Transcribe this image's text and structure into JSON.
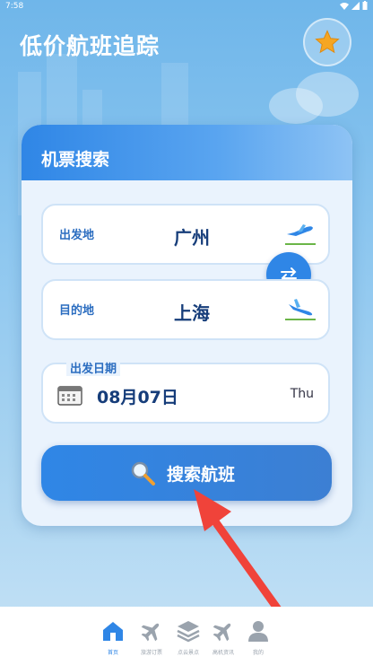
{
  "status": {
    "time": "7:58"
  },
  "header": {
    "title": "低价航班追踪",
    "favorite_icon": "star-icon"
  },
  "search_card": {
    "title": "机票搜索",
    "origin": {
      "label": "出发地",
      "value": "广州"
    },
    "destination": {
      "label": "目的地",
      "value": "上海"
    },
    "date": {
      "label": "出发日期",
      "value": "08月07日",
      "weekday": "Thu"
    },
    "search_button": "搜索航班"
  },
  "tabbar": {
    "items": [
      {
        "label": "首页",
        "icon": "home-icon",
        "active": true
      },
      {
        "label": "旅游订票",
        "icon": "plane-icon",
        "active": false
      },
      {
        "label": "点云景点",
        "icon": "layers-icon",
        "active": false
      },
      {
        "label": "高机资讯",
        "icon": "plane-icon",
        "active": false
      },
      {
        "label": "我的",
        "icon": "user-icon",
        "active": false
      }
    ]
  },
  "colors": {
    "accent": "#2f86e6",
    "star": "#f5a623",
    "arrow": "#f0433a"
  }
}
